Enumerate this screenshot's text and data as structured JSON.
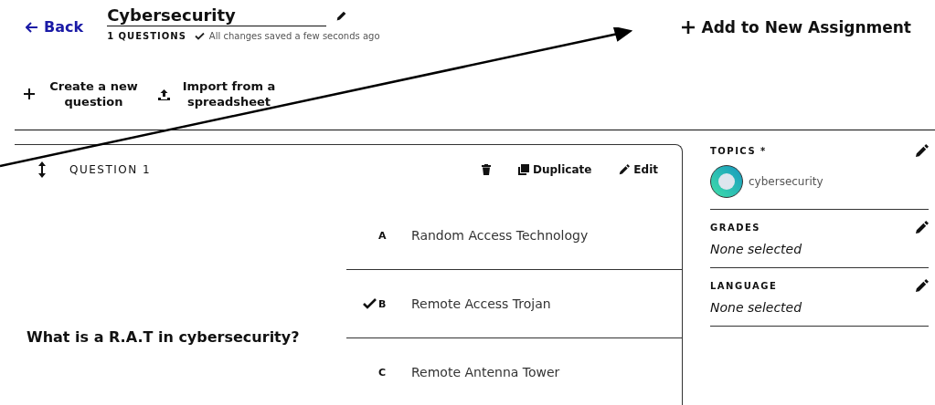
{
  "header": {
    "back": "Back",
    "title": "Cybersecurity",
    "question_count": "1 QUESTIONS",
    "save_status": "All changes saved a few seconds ago",
    "add_button": "Add to New Assignment"
  },
  "toolbar": [
    {
      "kind": "create",
      "label": "Create a new question"
    },
    {
      "kind": "import",
      "label": "Import from a spreadsheet"
    }
  ],
  "question": {
    "label": "QUESTION 1",
    "actions": [
      {
        "kind": "delete"
      },
      {
        "kind": "duplicate",
        "label": "Duplicate"
      },
      {
        "kind": "edit",
        "label": "Edit"
      }
    ],
    "text": "What is a R.A.T in cybersecurity?",
    "answers": [
      {
        "letter": "A",
        "text": "Random Access Technology",
        "correct": false
      },
      {
        "letter": "B",
        "text": "Remote Access Trojan",
        "correct": true
      },
      {
        "letter": "C",
        "text": "Remote Antenna Tower",
        "correct": false
      }
    ]
  },
  "sidebar": [
    {
      "kind": "tags",
      "label": "TOPICS *",
      "tags": [
        "cybersecurity"
      ]
    },
    {
      "kind": "text",
      "label": "GRADES",
      "value": "None selected"
    },
    {
      "kind": "text",
      "label": "LANGUAGE",
      "value": "None selected"
    }
  ]
}
